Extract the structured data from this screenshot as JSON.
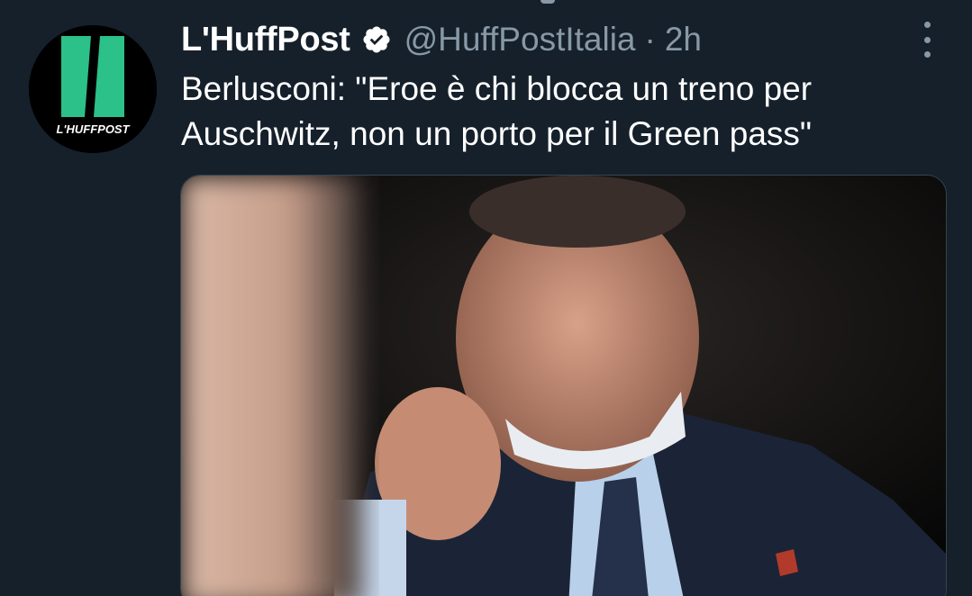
{
  "tweet": {
    "author": {
      "display_name": "L'HuffPost",
      "handle": "@HuffPostItalia",
      "verified": true,
      "avatar_logo_text": "L'HUFFPOST"
    },
    "separator": "·",
    "timestamp": "2h",
    "text": "Berlusconi: \"Eroe è chi blocca un treno per\nAuschwitz, non un porto per il Green pass\"",
    "media": {
      "type": "photo"
    }
  },
  "icons": {
    "verified": "verified-badge-icon",
    "more": "more-options-icon"
  },
  "colors": {
    "background": "#15202b",
    "secondary_text": "#8899a6",
    "huffpost_green": "#2bc189",
    "verified_badge": "#ffffff"
  }
}
